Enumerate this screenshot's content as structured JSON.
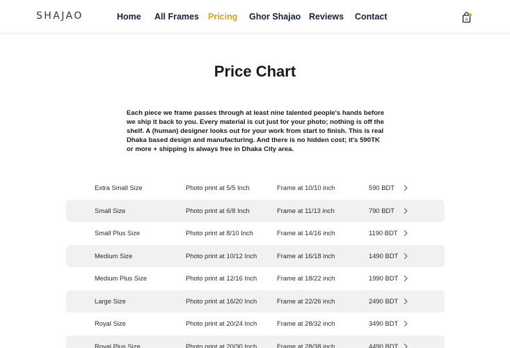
{
  "header": {
    "logo": "SHAJAO",
    "nav": [
      {
        "label": "Home",
        "active": false
      },
      {
        "label": "All Frames",
        "active": false
      },
      {
        "label": "Pricing",
        "active": true
      },
      {
        "label": "Ghor Shajao",
        "active": false
      },
      {
        "label": "Reviews",
        "active": false
      },
      {
        "label": "Contact",
        "active": false
      }
    ],
    "cart_icon": "shopping-bag-icon",
    "accent_color": "#e2a31c"
  },
  "main": {
    "title": "Price Chart",
    "intro": "Each piece we frame passes through at least nine talented people's hands before we ship it back to you. Every material is cut just for your photo; nothing is off the shelf. A (human) designer looks out for your work from start to finish. This is real Dhaka based design and manufacturing. And there is no hidden cost; it's 590TK or more + shipping is always free in Dhaka City area."
  },
  "prices": [
    {
      "size": "Extra Small Size",
      "print": "Photo print at 5/5 Inch",
      "frame": "Frame at 10/10 inch",
      "price": "590 BDT"
    },
    {
      "size": "Small Size",
      "print": "Photo print at 6/8 Inch",
      "frame": "Frame at 11/13 inch",
      "price": "790 BDT"
    },
    {
      "size": "Small Plus Size",
      "print": "Photo print at 8/10 Inch",
      "frame": "Frame at 14/16 inch",
      "price": "1190 BDT"
    },
    {
      "size": "Medium Size",
      "print": "Photo print at 10/12 Inch",
      "frame": "Frame at 16/18 inch",
      "price": "1490 BDT"
    },
    {
      "size": "Medium Plus Size",
      "print": "Photo print at 12/16 Inch",
      "frame": "Frame at 18/22 inch",
      "price": "1990 BDT"
    },
    {
      "size": "Large Size",
      "print": "Photo print at 16/20 Inch",
      "frame": "Frame at 22/26 inch",
      "price": "2490 BDT"
    },
    {
      "size": "Royal Size",
      "print": "Photo print at 20/24 Inch",
      "frame": "Frame at 28/32 inch",
      "price": "3490 BDT"
    },
    {
      "size": "Royal Plus Size",
      "print": "Photo print at 20/30 Inch",
      "frame": "Frame at 28/38 inch",
      "price": "4490 BDT"
    }
  ]
}
